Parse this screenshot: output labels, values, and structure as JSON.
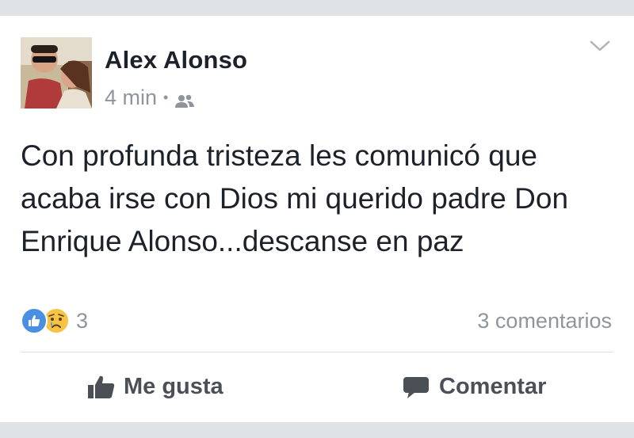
{
  "post": {
    "author": "Alex Alonso",
    "time": "4 min",
    "separator": "•",
    "audience_icon": "friends-icon",
    "menu_icon": "chevron-down-icon",
    "text": "Con profunda tristeza les comunicó que acaba irse con Dios mi querido padre Don Enrique Alonso...descanse en paz"
  },
  "reactions": {
    "types": [
      "like-reaction-icon",
      "sad-reaction-icon"
    ],
    "count": "3",
    "comments": "3 comentarios"
  },
  "actions": {
    "like_label": "Me gusta",
    "comment_label": "Comentar"
  },
  "colors": {
    "background": "#dfe3e6",
    "card": "#ffffff",
    "text": "#1d2129",
    "secondary": "#90949c",
    "action": "#4b4f56",
    "like_blue": "#4a90e2",
    "sad_yellow": "#f6c344"
  }
}
